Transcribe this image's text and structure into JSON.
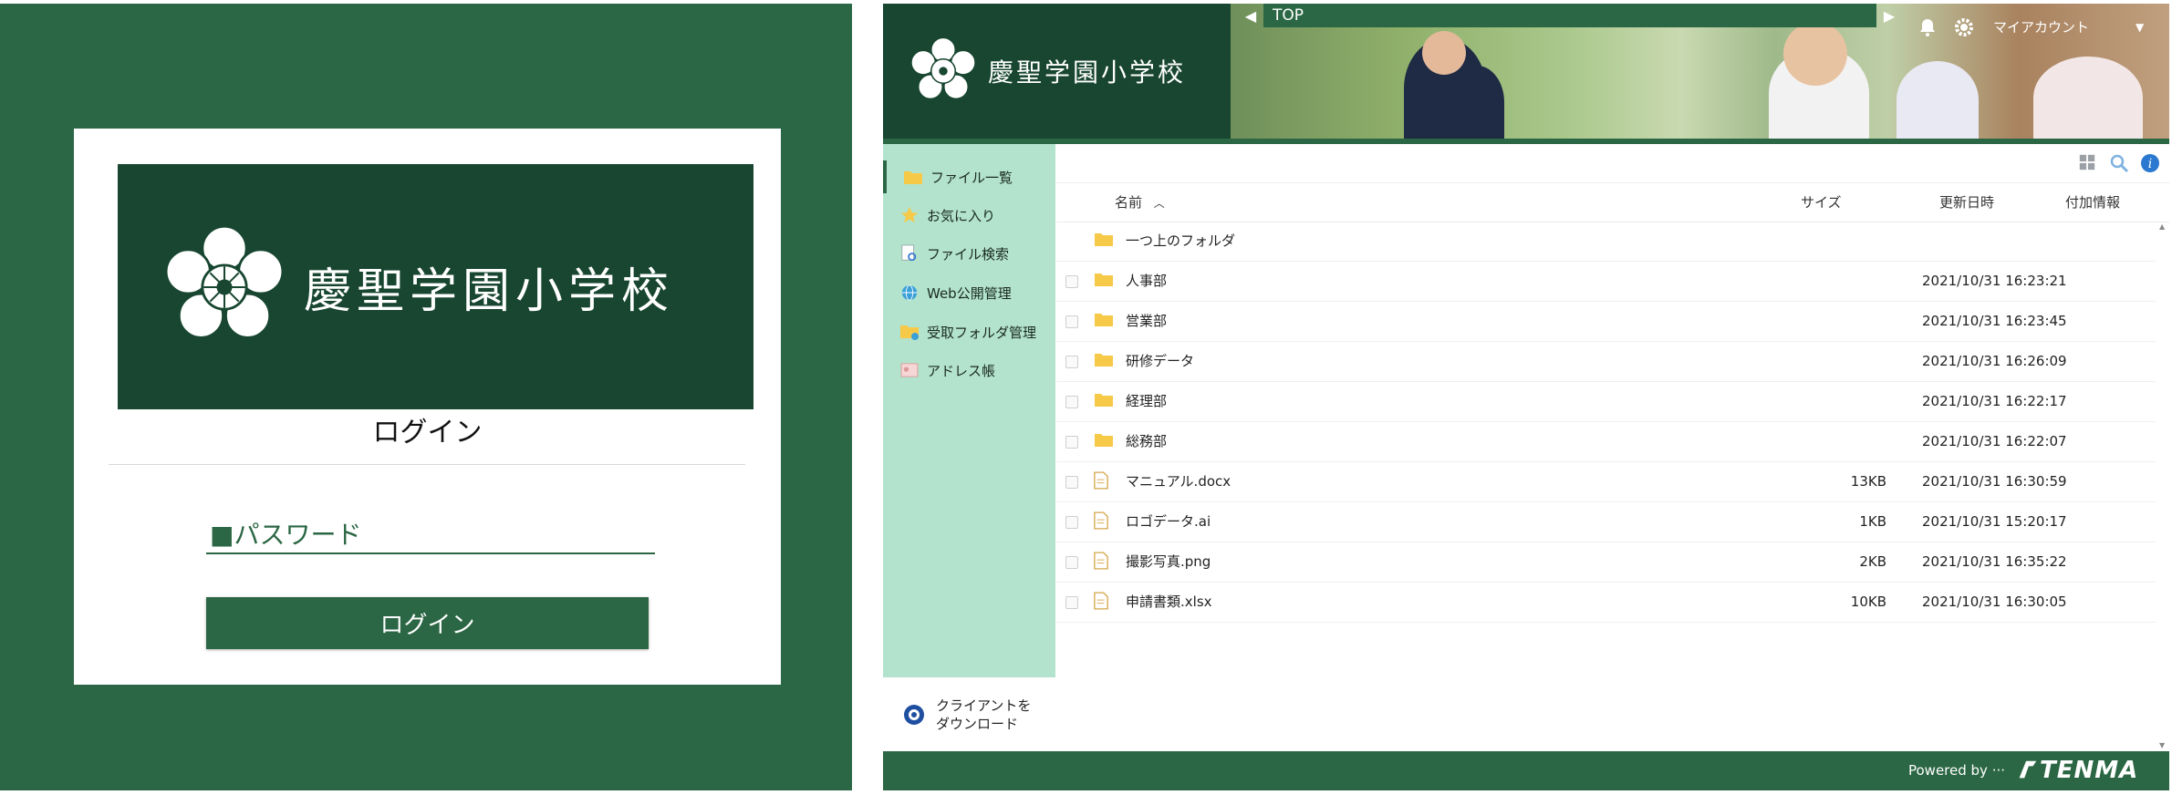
{
  "colors": {
    "brand_green": "#2b6744",
    "dark_green": "#184630",
    "sidebar_mint": "#b3e3cc",
    "folder_yellow": "#f7c948"
  },
  "login": {
    "school_name": "慶聖学園小学校",
    "title": "ログイン",
    "password_placeholder": "■パスワード",
    "button_label": "ログイン"
  },
  "file_manager": {
    "school_name": "慶聖学園小学校",
    "breadcrumb": "TOP",
    "account_label": "マイアカウント",
    "sidebar": {
      "items": [
        {
          "label": "ファイル一覧",
          "icon": "folder-icon"
        },
        {
          "label": "お気に入り",
          "icon": "star-icon"
        },
        {
          "label": "ファイル検索",
          "icon": "file-search-icon"
        },
        {
          "label": "Web公開管理",
          "icon": "globe-icon"
        },
        {
          "label": "受取フォルダ管理",
          "icon": "receive-folder-icon"
        },
        {
          "label": "アドレス帳",
          "icon": "address-book-icon"
        }
      ],
      "client_download": "クライアントをダウンロード"
    },
    "columns": {
      "name": "名前",
      "size": "サイズ",
      "updated": "更新日時",
      "info": "付加情報"
    },
    "rows": [
      {
        "name": "一つ上のフォルダ",
        "size": "",
        "updated": "",
        "type": "folder",
        "checkbox": false
      },
      {
        "name": "人事部",
        "size": "",
        "updated": "2021/10/31 16:23:21",
        "type": "folder",
        "checkbox": true
      },
      {
        "name": "営業部",
        "size": "",
        "updated": "2021/10/31 16:23:45",
        "type": "folder",
        "checkbox": true
      },
      {
        "name": "研修データ",
        "size": "",
        "updated": "2021/10/31 16:26:09",
        "type": "folder",
        "checkbox": true
      },
      {
        "name": "経理部",
        "size": "",
        "updated": "2021/10/31 16:22:17",
        "type": "folder",
        "checkbox": true
      },
      {
        "name": "総務部",
        "size": "",
        "updated": "2021/10/31 16:22:07",
        "type": "folder",
        "checkbox": true
      },
      {
        "name": "マニュアル.docx",
        "size": "13KB",
        "updated": "2021/10/31 16:30:59",
        "type": "file",
        "checkbox": true
      },
      {
        "name": "ロゴデータ.ai",
        "size": "1KB",
        "updated": "2021/10/31 15:20:17",
        "type": "file",
        "checkbox": true
      },
      {
        "name": "撮影写真.png",
        "size": "2KB",
        "updated": "2021/10/31 16:35:22",
        "type": "file",
        "checkbox": true
      },
      {
        "name": "申請書類.xlsx",
        "size": "10KB",
        "updated": "2021/10/31 16:30:05",
        "type": "file",
        "checkbox": true
      }
    ],
    "footer": {
      "powered_by": "Powered by ···",
      "brand": "TENMA"
    }
  }
}
